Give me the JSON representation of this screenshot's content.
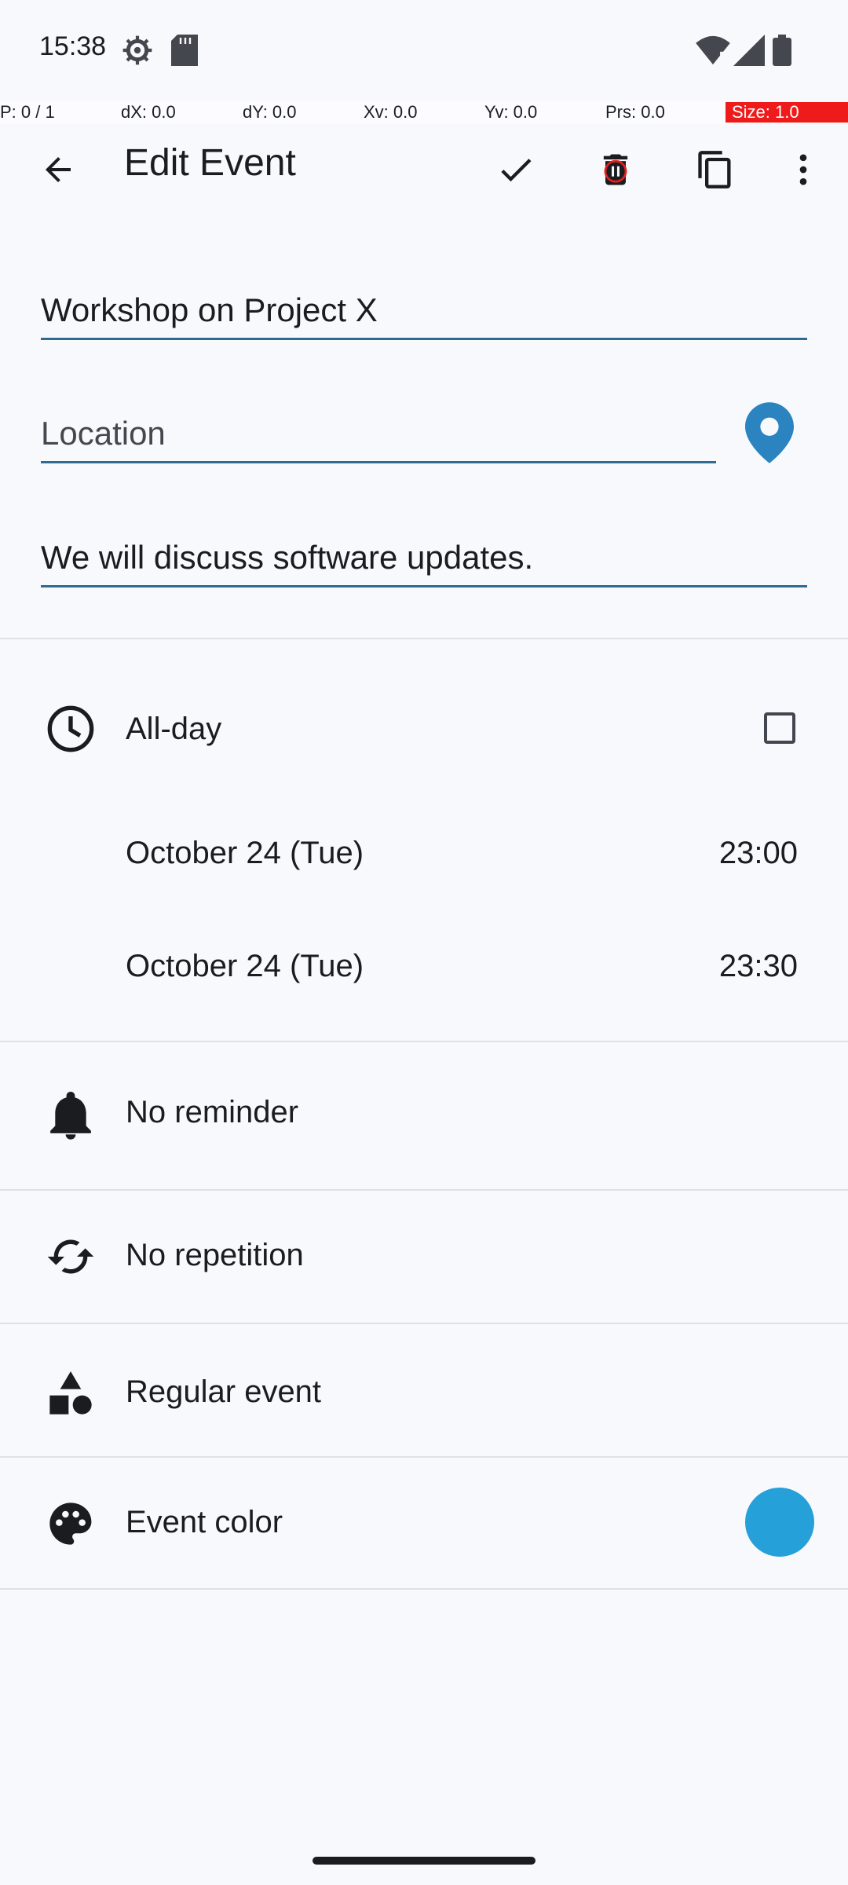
{
  "status_bar": {
    "time": "15:38",
    "icons": [
      "settings-icon",
      "sd-card-icon",
      "wifi-icon",
      "signal-icon",
      "battery-icon"
    ]
  },
  "debug_overlay": {
    "pointer": "P: 0 / 1",
    "dx": "dX: 0.0",
    "dy": "dY: 0.0",
    "xv": "Xv: 0.0",
    "yv": "Yv: 0.0",
    "prs": "Prs: 0.0",
    "size": "Size: 1.0"
  },
  "toolbar": {
    "title": "Edit Event",
    "icons": [
      "back-arrow-icon",
      "checkmark-icon",
      "delete-icon",
      "copy-icon",
      "more-options-icon"
    ]
  },
  "form": {
    "title_value": "Workshop on Project X",
    "location_placeholder": "Location",
    "description_value": "We will discuss software updates."
  },
  "all_day": {
    "label": "All-day",
    "checked": false
  },
  "start": {
    "date": "October 24 (Tue)",
    "time": "23:00"
  },
  "end": {
    "date": "October 24 (Tue)",
    "time": "23:30"
  },
  "reminder": {
    "label": "No reminder"
  },
  "repetition": {
    "label": "No repetition"
  },
  "event_type": {
    "label": "Regular event"
  },
  "event_color": {
    "label": "Event color",
    "value": "#26a0d8"
  },
  "colors": {
    "accent": "#2f6a92",
    "location_pin": "#2b83c0",
    "background": "#f8f9fd",
    "text": "#1b1c20"
  }
}
